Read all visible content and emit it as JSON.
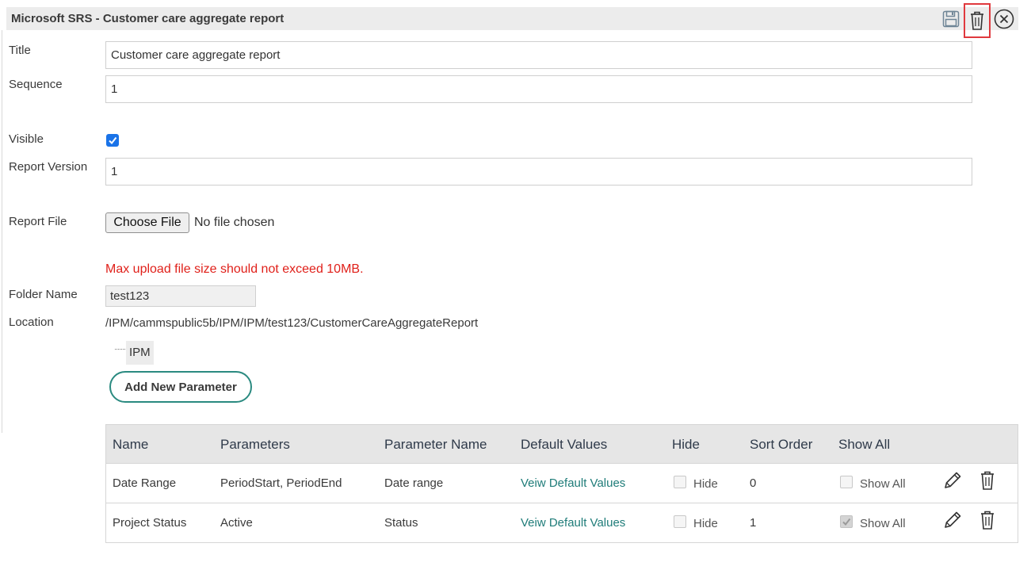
{
  "header": {
    "title": "Microsoft SRS - Customer care aggregate report",
    "icons": {
      "save": "save-icon",
      "delete": "trash-icon",
      "close": "close-circle-icon"
    },
    "delete_highlight_color": "#e0393e"
  },
  "form": {
    "title_label": "Title",
    "title_value": "Customer care aggregate report",
    "sequence_label": "Sequence",
    "sequence_value": "1",
    "visible_label": "Visible",
    "visible_checked": true,
    "report_version_label": "Report Version",
    "report_version_value": "1",
    "report_file_label": "Report File",
    "choose_file_label": "Choose File",
    "no_file_text": "No file chosen",
    "max_upload_note": "Max upload file size should not exceed 10MB.",
    "folder_name_label": "Folder Name",
    "folder_name_value": "test123",
    "location_label": "Location",
    "location_path": "/IPM/cammspublic5b/IPM/IPM/test123/CustomerCareAggregateReport",
    "tree_node": "IPM",
    "add_param_label": "Add New Parameter"
  },
  "params_table": {
    "columns": [
      "Name",
      "Parameters",
      "Parameter Name",
      "Default Values",
      "Hide",
      "Sort Order",
      "Show All"
    ],
    "rows": [
      {
        "name": "Date Range",
        "parameters": "PeriodStart, PeriodEnd",
        "parameter_name": "Date range",
        "default_values": "Veiw Default Values",
        "hide_label": "Hide",
        "hide_checked": false,
        "sort_order": "0",
        "show_all_label": "Show All",
        "show_all_checked": false
      },
      {
        "name": "Project Status",
        "parameters": "Active",
        "parameter_name": "Status",
        "default_values": "Veiw Default Values",
        "hide_label": "Hide",
        "hide_checked": false,
        "sort_order": "1",
        "show_all_label": "Show All",
        "show_all_checked": true
      }
    ]
  },
  "colors": {
    "accent_teal": "#2a8a80",
    "link": "#1f7c79",
    "warning": "#e0201a",
    "checkbox_blue": "#1a73e8"
  }
}
